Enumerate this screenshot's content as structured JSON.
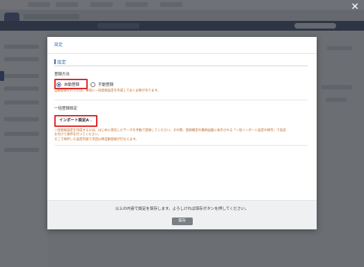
{
  "modal": {
    "title": "設定",
    "section_title": "設定",
    "registration_method_label": "登録方法",
    "options": [
      {
        "label": "自動登録",
        "selected": true
      },
      {
        "label": "手動登録",
        "selected": false
      }
    ],
    "auto_note": "自動登録を行うには、事前に一括登録設定を作成しておく必要があります。",
    "bulk_label": "一括登録設定",
    "bulk_select_value": "インポート設定A",
    "bulk_note_lines": [
      "一括登録設定を作成するには、はじめに受信したデータを手動で登録してください。その際、登録確定の最終画面に表示される「一括インポート設定の保存」で名前",
      "を付けて保存を行ってください。",
      "そこで保存した設定内容で次回以降自動登録が行なえます。"
    ],
    "footer_message": "以上の内容で設定を保存します。よろしければ保存ボタンを押してください。",
    "save_label": "保存"
  },
  "close_icon": "close-icon",
  "colors": {
    "accent_blue": "#3a6ea5",
    "highlight_red": "#e02727",
    "note_orange": "#c0651f",
    "save_button": "#7a7f86"
  }
}
